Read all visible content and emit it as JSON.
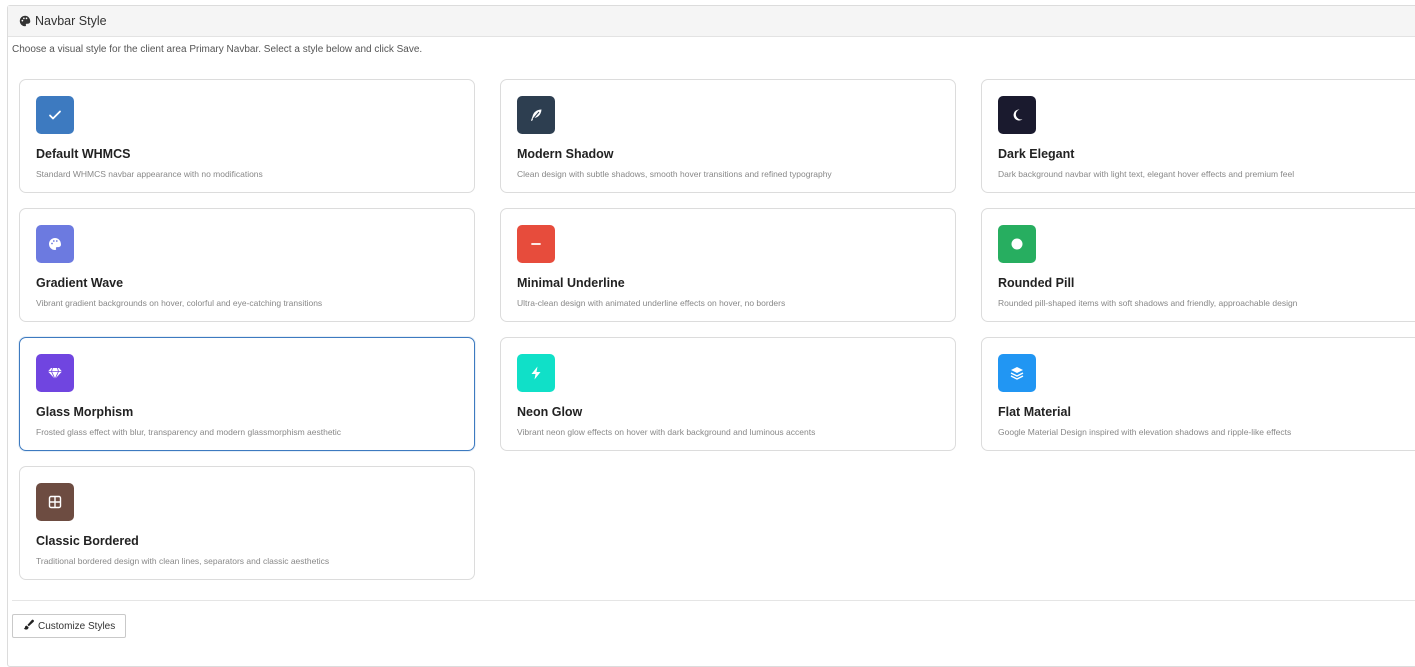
{
  "panel": {
    "title": "Navbar Style",
    "title_icon": "palette-icon",
    "intro": "Choose a visual style for the client area Primary Navbar. Select a style below and click Save."
  },
  "styles": [
    {
      "title": "Default WHMCS",
      "desc": "Standard WHMCS navbar appearance with no modifications",
      "icon": "check-icon",
      "color": "#3d7ac0"
    },
    {
      "title": "Modern Shadow",
      "desc": "Clean design with subtle shadows, smooth hover transitions and refined typography",
      "icon": "feather-icon",
      "color": "#2d3e50"
    },
    {
      "title": "Dark Elegant",
      "desc": "Dark background navbar with light text, elegant hover effects and premium feel",
      "icon": "moon-icon",
      "color": "#1a1a2e"
    },
    {
      "title": "Gradient Wave",
      "desc": "Vibrant gradient backgrounds on hover, colorful and eye-catching transitions",
      "icon": "palette-icon",
      "color": "#6c7ae0"
    },
    {
      "title": "Minimal Underline",
      "desc": "Ultra-clean design with animated underline effects on hover, no borders",
      "icon": "minus-icon",
      "color": "#e74c3c"
    },
    {
      "title": "Rounded Pill",
      "desc": "Rounded pill-shaped items with soft shadows and friendly, approachable design",
      "icon": "circle-icon",
      "color": "#27ae60"
    },
    {
      "title": "Glass Morphism",
      "desc": "Frosted glass effect with blur, transparency and modern glassmorphism aesthetic",
      "icon": "gem-icon",
      "color": "#7045e0"
    },
    {
      "title": "Neon Glow",
      "desc": "Vibrant neon glow effects on hover with dark background and luminous accents",
      "icon": "bolt-icon",
      "color": "#10e0c8"
    },
    {
      "title": "Flat Material",
      "desc": "Google Material Design inspired with elevation shadows and ripple-like effects",
      "icon": "layers-icon",
      "color": "#2196f3"
    },
    {
      "title": "Classic Bordered",
      "desc": "Traditional bordered design with clean lines, separators and classic aesthetics",
      "icon": "grid-icon",
      "color": "#6d4c41"
    }
  ],
  "selected_style": "Glass Morphism",
  "footer": {
    "button_label": "Customize Styles",
    "button_icon": "paintbrush-icon"
  }
}
